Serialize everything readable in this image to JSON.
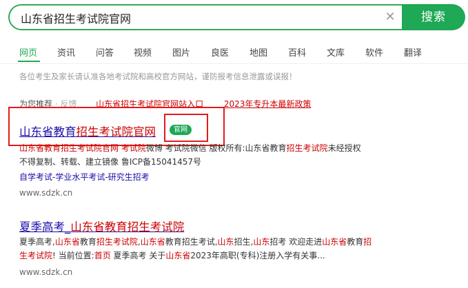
{
  "search": {
    "query": "山东省招生考试院官网",
    "button_label": "搜索"
  },
  "tabs": [
    "网页",
    "资讯",
    "问答",
    "视频",
    "图片",
    "良医",
    "地图",
    "百科",
    "文库",
    "软件",
    "翻译"
  ],
  "notice": "各位考生及家长请认准各地考试院和高校官方网站，谨防报考信息泄露或误报！",
  "recommend": {
    "label": "为您推荐",
    "feedback": "· 反馈",
    "links": [
      "山东省招生考试院官网站入口",
      "2023年专升本最新政策"
    ]
  },
  "result1": {
    "title_a": "山东省教育",
    "title_b": "招生考试院官网",
    "badge": "官网",
    "snippet1_parts": [
      "山东省教育",
      "招生考试院",
      "官网 考试院",
      "微博 考试院",
      "微信 版权所有:山东省教育",
      "招生考试院",
      "未经授权"
    ],
    "snippet2": "不得复制、转载、建立镜像 鲁ICP备15041457号",
    "sitelinks": "自学考试-学业水平考试-研究生招考",
    "url": "www.sdzk.cn"
  },
  "result2": {
    "title_a": "夏季高考_",
    "title_b": "山东省教育",
    "title_c": "招生考试院",
    "snippet1_parts": [
      "夏季高考,",
      "山东省",
      "教育",
      "招生考试院",
      ",",
      "山东省",
      "教育招生考试,",
      "山东",
      "招生,",
      "山东",
      "招考 欢迎走进",
      "山东省",
      "教育",
      "招"
    ],
    "snippet2_parts": [
      "生考试院",
      "! 当前位置:",
      "首页",
      " 夏季高考 关于",
      "山东省",
      "2023年高职(专科)注册入学有关事..."
    ],
    "url": "www.sdzk.cn"
  },
  "colors": {
    "accent": "#1fa855",
    "link": "#1a0dab",
    "highlight": "#cc0000",
    "annotation": "#e01b1b"
  }
}
